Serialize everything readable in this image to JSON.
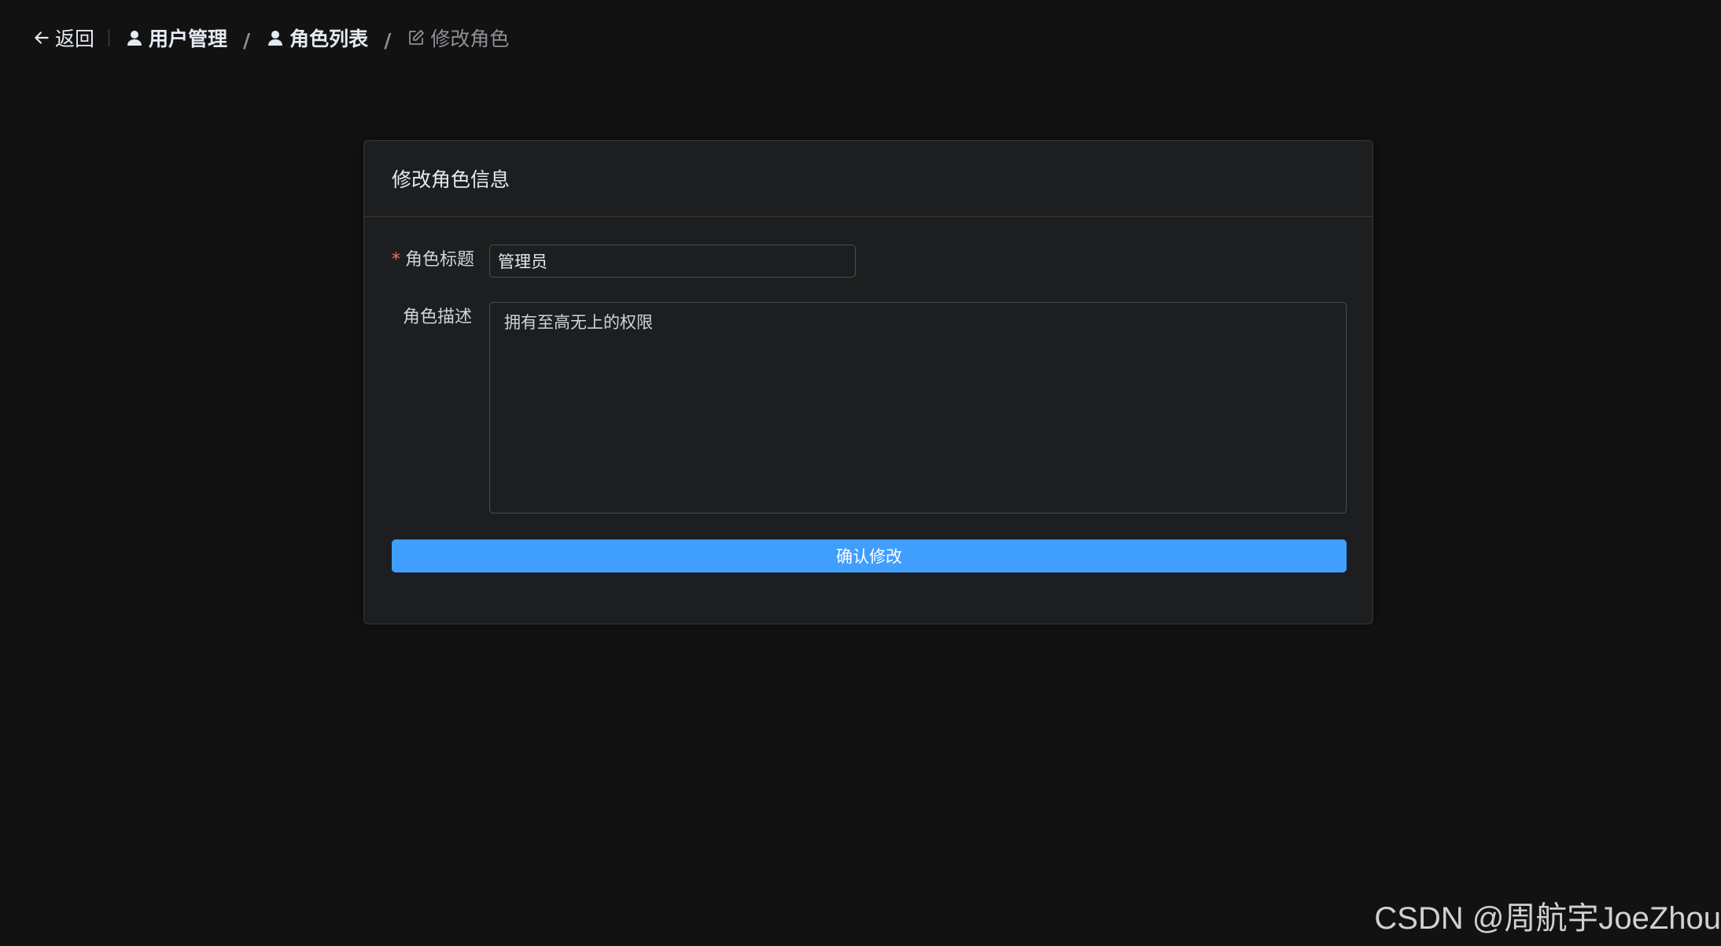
{
  "header": {
    "back_label": "返回",
    "breadcrumbs": [
      {
        "label": "用户管理",
        "icon": "user-icon"
      },
      {
        "label": "角色列表",
        "icon": "user-icon"
      },
      {
        "label": "修改角色",
        "icon": "edit-icon"
      }
    ],
    "separator": "/"
  },
  "card": {
    "title": "修改角色信息",
    "fields": {
      "role_title": {
        "required_mark": "*",
        "label": "角色标题",
        "value": "管理员"
      },
      "role_desc": {
        "label": "角色描述",
        "value": "拥有至高无上的权限"
      }
    },
    "submit_label": "确认修改"
  },
  "watermark": "CSDN @周航宇JoeZhou",
  "colors": {
    "background": "#121212",
    "card": "#1d1e1f",
    "primary": "#409eff",
    "required": "#f56c6c"
  }
}
